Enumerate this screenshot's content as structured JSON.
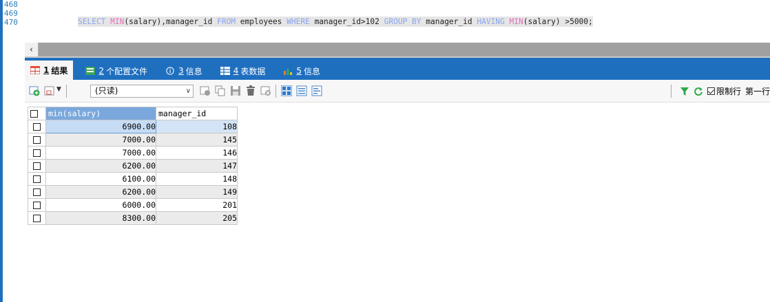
{
  "editor": {
    "line_numbers": [
      "468",
      "469",
      "470"
    ],
    "sql_tokens": [
      {
        "t": "SELECT",
        "c": "kw"
      },
      {
        "t": " ",
        "c": "tx"
      },
      {
        "t": "MIN",
        "c": "fn"
      },
      {
        "t": "(salary),manager_id ",
        "c": "tx"
      },
      {
        "t": "FROM",
        "c": "kw"
      },
      {
        "t": " employees ",
        "c": "tx"
      },
      {
        "t": "WHERE",
        "c": "kw"
      },
      {
        "t": " manager_id>102 ",
        "c": "tx"
      },
      {
        "t": "GROUP BY",
        "c": "kw"
      },
      {
        "t": " manager_id ",
        "c": "tx"
      },
      {
        "t": "HAVING",
        "c": "kw"
      },
      {
        "t": " ",
        "c": "tx"
      },
      {
        "t": "MIN",
        "c": "fn"
      },
      {
        "t": "(salary) >5000;",
        "c": "tx"
      }
    ]
  },
  "scrollbar": {
    "left_arrow": "‹"
  },
  "tabs": [
    {
      "num": "1",
      "label": "结果",
      "icon": "grid-result-icon",
      "active": true
    },
    {
      "num": "2",
      "label": "个配置文件",
      "icon": "profile-icon",
      "active": false
    },
    {
      "num": "3",
      "label": "信息",
      "icon": "info-icon",
      "active": false
    },
    {
      "num": "4",
      "label": "表数据",
      "icon": "table-data-icon",
      "active": false
    },
    {
      "num": "5",
      "label": "信息",
      "icon": "chart-info-icon",
      "active": false
    }
  ],
  "toolbar": {
    "mode_select": "(只读)",
    "limit_rows_label": "限制行",
    "first_row_label": "第一行"
  },
  "grid": {
    "columns": [
      "min(salary)",
      "manager_id"
    ],
    "rows": [
      [
        "6900.00",
        "108"
      ],
      [
        "7000.00",
        "145"
      ],
      [
        "7000.00",
        "146"
      ],
      [
        "6200.00",
        "147"
      ],
      [
        "6100.00",
        "148"
      ],
      [
        "6200.00",
        "149"
      ],
      [
        "6000.00",
        "201"
      ],
      [
        "8300.00",
        "205"
      ]
    ]
  },
  "colors": {
    "tab_bar": "#1f6fbf",
    "header_selected": "#7aa8dc"
  }
}
